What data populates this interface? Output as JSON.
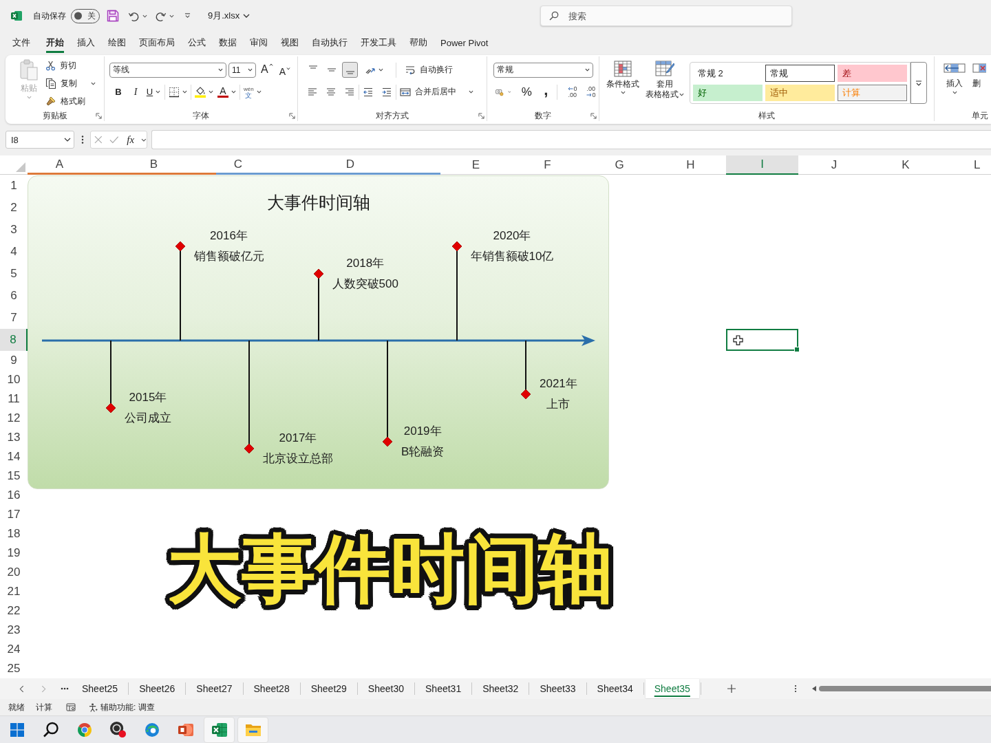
{
  "title_bar": {
    "autosave_label": "自动保存",
    "autosave": {
      "label": "关",
      "on": false
    },
    "file_name": "9月.xlsx"
  },
  "search": {
    "placeholder": "搜索"
  },
  "menu_tabs": [
    {
      "label": "文件",
      "selected": false
    },
    {
      "label": "开始",
      "selected": true
    },
    {
      "label": "插入",
      "selected": false
    },
    {
      "label": "绘图",
      "selected": false
    },
    {
      "label": "页面布局",
      "selected": false
    },
    {
      "label": "公式",
      "selected": false
    },
    {
      "label": "数据",
      "selected": false
    },
    {
      "label": "审阅",
      "selected": false
    },
    {
      "label": "视图",
      "selected": false
    },
    {
      "label": "自动执行",
      "selected": false
    },
    {
      "label": "开发工具",
      "selected": false
    },
    {
      "label": "帮助",
      "selected": false
    },
    {
      "label": "Power Pivot",
      "selected": false
    }
  ],
  "ribbon": {
    "clipboard": {
      "label": "剪贴板",
      "paste": {
        "label": "粘贴",
        "disabled": true
      },
      "cut": "剪切",
      "copy": "复制",
      "format_painter": "格式刷"
    },
    "font": {
      "label": "字体",
      "font_name": "等线",
      "font_size": "11",
      "grow": "A",
      "shrink": "A",
      "bold": "B",
      "italic": "I",
      "underline": "U",
      "font_color": "A",
      "phonetic": [
        "wén",
        "文"
      ]
    },
    "alignment": {
      "label": "对齐方式",
      "vertical": [
        {
          "kind": "top",
          "selected": false
        },
        {
          "kind": "middle",
          "selected": false
        },
        {
          "kind": "bottom",
          "selected": true
        }
      ],
      "wrap_text": "自动换行",
      "merge_center": "合并后居中"
    },
    "number": {
      "label": "数字",
      "format": "常规",
      "percent": "%",
      "comma": ",",
      "increase_decimal": [
        "0",
        ".00"
      ],
      "decrease_decimal": [
        ".00",
        "0"
      ]
    },
    "styles": {
      "label": "样式",
      "conditional_formatting": "条件格式",
      "format_as_table": [
        "套用",
        "表格格式"
      ],
      "gallery": [
        {
          "label": "常规 2",
          "kind": "normal",
          "selected": false
        },
        {
          "label": "常规",
          "kind": "normal",
          "selected": true
        },
        {
          "label": "差",
          "kind": "bad",
          "selected": false
        },
        {
          "label": "好",
          "kind": "good",
          "selected": false
        },
        {
          "label": "适中",
          "kind": "neutral",
          "selected": false
        },
        {
          "label": "计算",
          "kind": "calculation",
          "selected": false
        }
      ]
    },
    "cells": {
      "label": "单元",
      "insert": "插入",
      "delete": "删"
    }
  },
  "formula_bar": {
    "name_box": "I8",
    "function_label": "fx"
  },
  "sheet": {
    "columns": [
      {
        "label": "A",
        "selected": false,
        "color": "#dd7a3a"
      },
      {
        "label": "B",
        "selected": false,
        "color": "#dd7a3a"
      },
      {
        "label": "C",
        "selected": false,
        "color": "#6a9bd0"
      },
      {
        "label": "D",
        "selected": false,
        "color": "#6a9bd0"
      },
      {
        "label": "E",
        "selected": false
      },
      {
        "label": "F",
        "selected": false
      },
      {
        "label": "G",
        "selected": false
      },
      {
        "label": "H",
        "selected": false
      },
      {
        "label": "I",
        "selected": true
      },
      {
        "label": "J",
        "selected": false
      },
      {
        "label": "K",
        "selected": false
      },
      {
        "label": "L",
        "selected": false
      }
    ],
    "rows": [
      {
        "label": "1",
        "selected": false
      },
      {
        "label": "2",
        "selected": false
      },
      {
        "label": "3",
        "selected": false
      },
      {
        "label": "4",
        "selected": false
      },
      {
        "label": "5",
        "selected": false
      },
      {
        "label": "6",
        "selected": false
      },
      {
        "label": "7",
        "selected": false
      },
      {
        "label": "8",
        "selected": true
      },
      {
        "label": "9",
        "selected": false
      },
      {
        "label": "10",
        "selected": false
      },
      {
        "label": "11",
        "selected": false
      },
      {
        "label": "12",
        "selected": false
      },
      {
        "label": "13",
        "selected": false
      },
      {
        "label": "14",
        "selected": false
      },
      {
        "label": "15",
        "selected": false
      },
      {
        "label": "16",
        "selected": false
      },
      {
        "label": "17",
        "selected": false
      },
      {
        "label": "18",
        "selected": false
      },
      {
        "label": "19",
        "selected": false
      },
      {
        "label": "20",
        "selected": false
      },
      {
        "label": "21",
        "selected": false
      },
      {
        "label": "22",
        "selected": false
      },
      {
        "label": "23",
        "selected": false
      },
      {
        "label": "24",
        "selected": false
      },
      {
        "label": "25",
        "selected": false
      }
    ]
  },
  "timeline": {
    "title": "大事件时间轴",
    "events": [
      {
        "year": "2015年",
        "text": "公司成立",
        "kind": "below"
      },
      {
        "year": "2016年",
        "text": "销售额破亿元",
        "kind": "above"
      },
      {
        "year": "2017年",
        "text": "北京设立总部",
        "kind": "below"
      },
      {
        "year": "2018年",
        "text": "人数突破500",
        "kind": "above"
      },
      {
        "year": "2019年",
        "text": "B轮融资",
        "kind": "below"
      },
      {
        "year": "2020年",
        "text": "年销售额破10亿",
        "kind": "above"
      },
      {
        "year": "2021年",
        "text": "上市",
        "kind": "below"
      }
    ]
  },
  "caption": "大事件时间轴",
  "sheet_tabs": [
    {
      "label": "Sheet25",
      "selected": false
    },
    {
      "label": "Sheet26",
      "selected": false
    },
    {
      "label": "Sheet27",
      "selected": false
    },
    {
      "label": "Sheet28",
      "selected": false
    },
    {
      "label": "Sheet29",
      "selected": false
    },
    {
      "label": "Sheet30",
      "selected": false
    },
    {
      "label": "Sheet31",
      "selected": false
    },
    {
      "label": "Sheet32",
      "selected": false
    },
    {
      "label": "Sheet33",
      "selected": false
    },
    {
      "label": "Sheet34",
      "selected": false
    },
    {
      "label": "Sheet35",
      "selected": true
    }
  ],
  "status_bar": {
    "mode": "就绪",
    "calculate": "计算",
    "accessibility": "辅助功能: 调查"
  },
  "taskbar": [
    {
      "kind": "start",
      "active": false
    },
    {
      "kind": "search",
      "active": false
    },
    {
      "kind": "browser",
      "active": false
    },
    {
      "kind": "recorder",
      "active": false
    },
    {
      "kind": "edge",
      "active": false
    },
    {
      "kind": "presentation",
      "active": false
    },
    {
      "kind": "spreadsheet",
      "active": true
    },
    {
      "kind": "files",
      "active": true
    }
  ]
}
